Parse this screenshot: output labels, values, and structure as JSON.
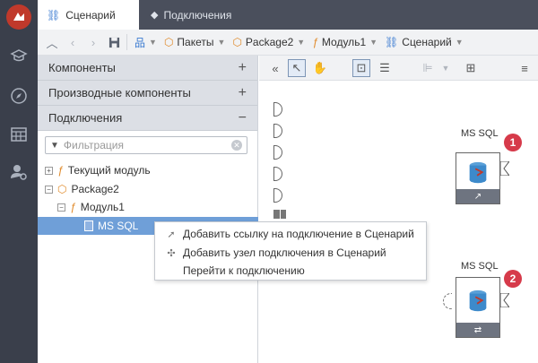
{
  "tabs": [
    {
      "label": "Сценарий",
      "active": true
    },
    {
      "label": "Подключения",
      "active": false
    }
  ],
  "breadcrumbs": [
    {
      "label": "Пакеты"
    },
    {
      "label": "Package2"
    },
    {
      "label": "Модуль1"
    },
    {
      "label": "Сценарий"
    }
  ],
  "panel": {
    "sections": [
      {
        "label": "Компоненты",
        "toggle": "+"
      },
      {
        "label": "Производные компоненты",
        "toggle": "+"
      },
      {
        "label": "Подключения",
        "toggle": "−"
      }
    ],
    "filter_placeholder": "Фильтрация",
    "tree": [
      {
        "label": "Текущий модуль"
      },
      {
        "label": "Package2"
      },
      {
        "label": "Модуль1"
      },
      {
        "label": "MS SQL"
      }
    ]
  },
  "nodes": [
    {
      "label": "MS SQL",
      "badge": "1"
    },
    {
      "label": "MS SQL",
      "badge": "2"
    }
  ],
  "context_menu": [
    {
      "label": "Добавить ссылку на подключение в Сценарий"
    },
    {
      "label": "Добавить узел подключения в Сценарий"
    },
    {
      "label": "Перейти к подключению"
    }
  ],
  "colors": {
    "rail": "#3a3f4b",
    "tabbar": "#4a4f5c",
    "selection": "#6f9fd8",
    "badge": "#d63a4a",
    "logo": "#c0392b"
  }
}
